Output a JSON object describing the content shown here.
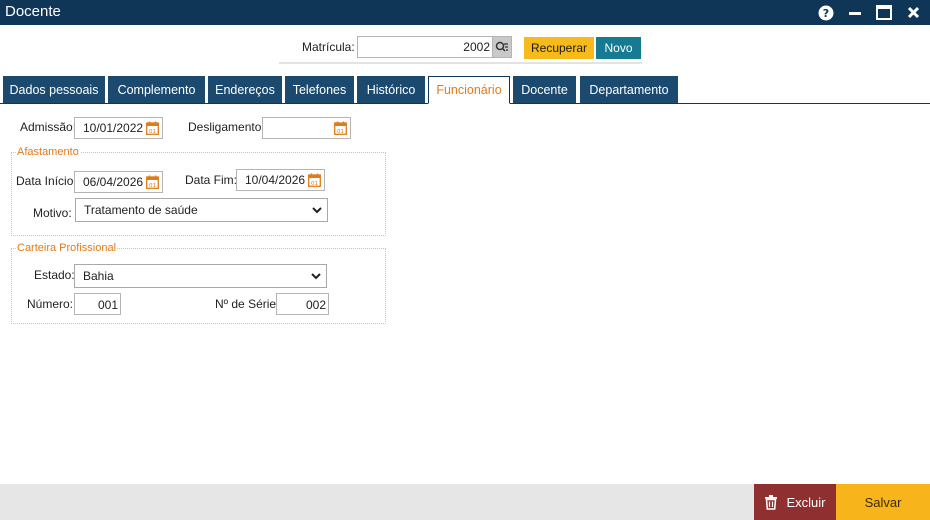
{
  "window": {
    "title": "Docente",
    "help_icon": "help-circle-icon",
    "minimize_icon": "minimize-icon",
    "maximize_icon": "maximize-icon",
    "close_icon": "close-icon"
  },
  "matricula": {
    "label": "Matrícula:",
    "value": "2002",
    "search_icon": "search-list-icon",
    "recuperar_label": "Recuperar",
    "novo_label": "Novo"
  },
  "tabs": [
    {
      "label": "Dados pessoais",
      "active": false
    },
    {
      "label": "Complemento",
      "active": false
    },
    {
      "label": "Endereços",
      "active": false
    },
    {
      "label": "Telefones",
      "active": false
    },
    {
      "label": "Histórico",
      "active": false
    },
    {
      "label": "Funcionário",
      "active": true
    },
    {
      "label": "Docente",
      "active": false
    },
    {
      "label": "Departamento",
      "active": false
    }
  ],
  "funcionario": {
    "admissao_label": "Admissão:",
    "admissao_value": "10/01/2022",
    "desligamento_label": "Desligamento:",
    "desligamento_value": "",
    "afastamento": {
      "legend": "Afastamento",
      "data_inicio_label": "Data Início:",
      "data_inicio_value": "06/04/2026",
      "data_fim_label": "Data Fim:",
      "data_fim_value": "10/04/2026",
      "motivo_label": "Motivo:",
      "motivo_value": "Tratamento de saúde"
    },
    "carteira": {
      "legend": "Carteira Profissional",
      "estado_label": "Estado:",
      "estado_value": "Bahia",
      "numero_label": "Número:",
      "numero_value": "001",
      "serie_label": "Nº de Série:",
      "serie_value": "002"
    }
  },
  "footer": {
    "excluir_label": "Excluir",
    "excluir_icon": "trash-icon",
    "salvar_label": "Salvar"
  },
  "colors": {
    "titlebar": "#0f3557",
    "tab": "#1b4a6e",
    "tab_active_text": "#e07b1a",
    "recuperar": "#f6ba1a",
    "novo": "#177a93",
    "excluir": "#8f2f2f",
    "salvar": "#f8b51b",
    "calendar_icon": "#e07b1a"
  }
}
